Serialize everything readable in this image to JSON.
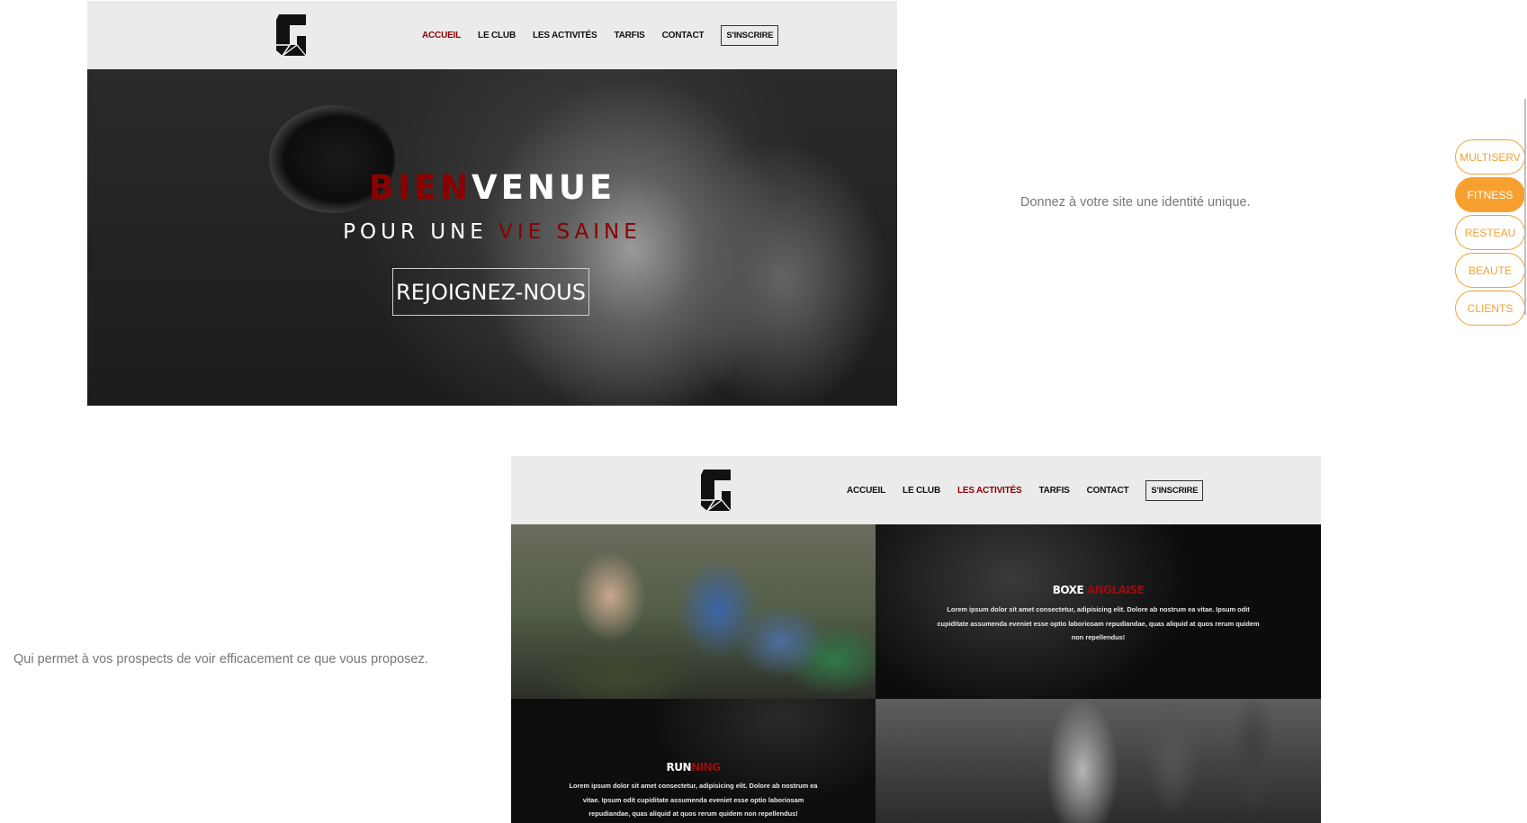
{
  "mockup1": {
    "nav": [
      "ACCUEIL",
      "LE CLUB",
      "LES ACTIVITÉS",
      "TARFIS",
      "CONTACT"
    ],
    "register": "S'INSCRIRE",
    "hero": {
      "title_red": "BIEN",
      "title_white": "VENUE",
      "subtitle_white": "POUR UNE ",
      "subtitle_red": "VIE SAINE",
      "button": "REJOIGNEZ-NOUS"
    }
  },
  "caption1": "Donnez à votre site une identité unique.",
  "caption2": "Qui permet à vos prospects de voir efficacement ce que vous proposez.",
  "mockup2": {
    "nav": [
      "ACCUEIL",
      "LE CLUB",
      "LES ACTIVITÉS",
      "TARFIS",
      "CONTACT"
    ],
    "register": "S'INSCRIRE",
    "boxe": {
      "title_white": "BOXE ",
      "title_red": "ANGLAISE",
      "text_line1": "Lorem ipsum dolor sit amet consectetur, adipisicing elit. Dolore ab nostrum ea vitae. Ipsum odit",
      "text_line2": "cupiditate assumenda eveniet esse optio laboriosam repudiandae, quas aliquid at quos rerum quidem",
      "text_line3": "non repellendus!"
    },
    "run": {
      "title_white": "RUN",
      "title_red": "NING",
      "text_line1": "Lorem ipsum dolor sit amet consectetur, adipisicing elit. Dolore ab nostrum ea",
      "text_line2": "vitae. Ipsum odit cupiditate assumenda eveniet esse optio laboriosam",
      "text_line3": "repudiandae, quas aliquid at quos rerum quidem non repellendus!"
    }
  },
  "side_menu": [
    "MULTISERV",
    "FITNESS",
    "RESTEAU",
    "BEAUTE",
    "CLIENTS"
  ],
  "active_side_item": "FITNESS",
  "colors": {
    "accent": "#f7a02f",
    "brand_red": "#8b0000"
  }
}
